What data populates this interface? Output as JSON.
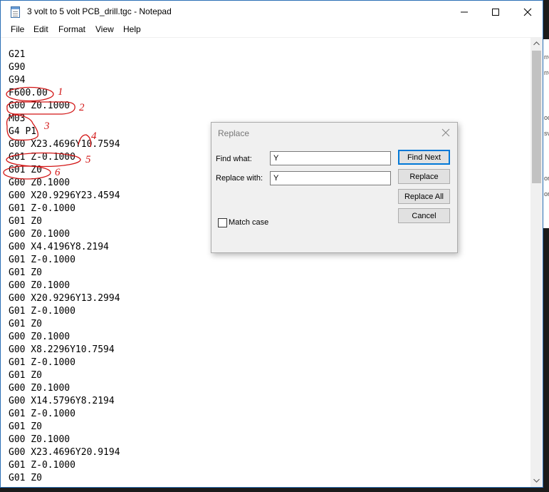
{
  "window": {
    "title": "3 volt to 5 volt PCB_drill.tgc - Notepad",
    "icon": "notepad-icon"
  },
  "menu": [
    "File",
    "Edit",
    "Format",
    "View",
    "Help"
  ],
  "editor": {
    "lines": [
      "G21",
      "G90",
      "G94",
      "F600.00",
      "G00 Z0.1000",
      "M03",
      "G4 P1",
      "G00 X23.4696Y10.7594",
      "G01 Z-0.1000",
      "G01 Z0",
      "G00 Z0.1000",
      "G00 X20.9296Y23.4594",
      "G01 Z-0.1000",
      "G01 Z0",
      "G00 Z0.1000",
      "G00 X4.4196Y8.2194",
      "G01 Z-0.1000",
      "G01 Z0",
      "G00 Z0.1000",
      "G00 X20.9296Y13.2994",
      "G01 Z-0.1000",
      "G01 Z0",
      "G00 Z0.1000",
      "G00 X8.2296Y10.7594",
      "G01 Z-0.1000",
      "G01 Z0",
      "G00 Z0.1000",
      "G00 X14.5796Y8.2194",
      "G01 Z-0.1000",
      "G01 Z0",
      "G00 Z0.1000",
      "G00 X23.4696Y20.9194",
      "G01 Z-0.1000",
      "G01 Z0"
    ]
  },
  "annotations": {
    "color": "#d21414",
    "numbers": [
      "1",
      "2",
      "3",
      "4",
      "5",
      "6"
    ]
  },
  "replace_dialog": {
    "title": "Replace",
    "find_label": "Find what:",
    "find_value": "Y",
    "replace_label": "Replace with:",
    "replace_value": "Y",
    "buttons": {
      "find_next": "Find Next",
      "replace": "Replace",
      "replace_all": "Replace All",
      "cancel": "Cancel"
    },
    "match_case_label": "Match case",
    "match_case_checked": false
  },
  "background_fragments": [
    "rre",
    "rre",
    "oc",
    "sv",
    "or",
    "or"
  ],
  "colors": {
    "window_border": "#2b6fb6",
    "dialog_bg": "#f0f0f0",
    "default_button_border": "#0078d7"
  }
}
